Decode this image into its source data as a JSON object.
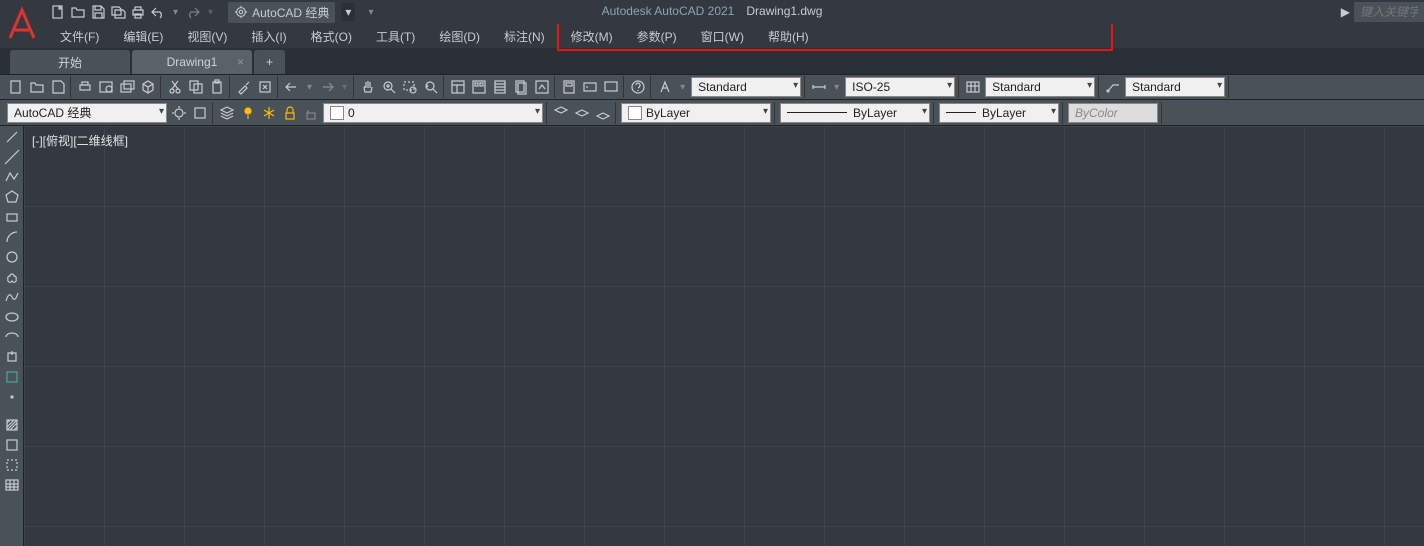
{
  "titlebar": {
    "app_name": "Autodesk AutoCAD 2021",
    "document": "Drawing1.dwg",
    "workspace_label": "AutoCAD 经典",
    "search_placeholder": "键入关键字或"
  },
  "menubar": {
    "items": [
      "文件(F)",
      "编辑(E)",
      "视图(V)",
      "插入(I)",
      "格式(O)",
      "工具(T)",
      "绘图(D)",
      "标注(N)",
      "修改(M)",
      "参数(P)",
      "窗口(W)",
      "帮助(H)"
    ]
  },
  "tabs": {
    "start": "开始",
    "drawing": "Drawing1"
  },
  "toolbar1": {
    "textstyle": "Standard",
    "dimstyle": "ISO-25",
    "tablestyle": "Standard",
    "mlstyle": "Standard"
  },
  "toolbar2": {
    "workspace": "AutoCAD 经典",
    "layer": "0",
    "linetype_color": "ByLayer",
    "linetype": "ByLayer",
    "lineweight": "ByLayer",
    "plotstyle": "ByColor"
  },
  "canvas": {
    "view_label": "[-][俯视][二维线框]"
  }
}
